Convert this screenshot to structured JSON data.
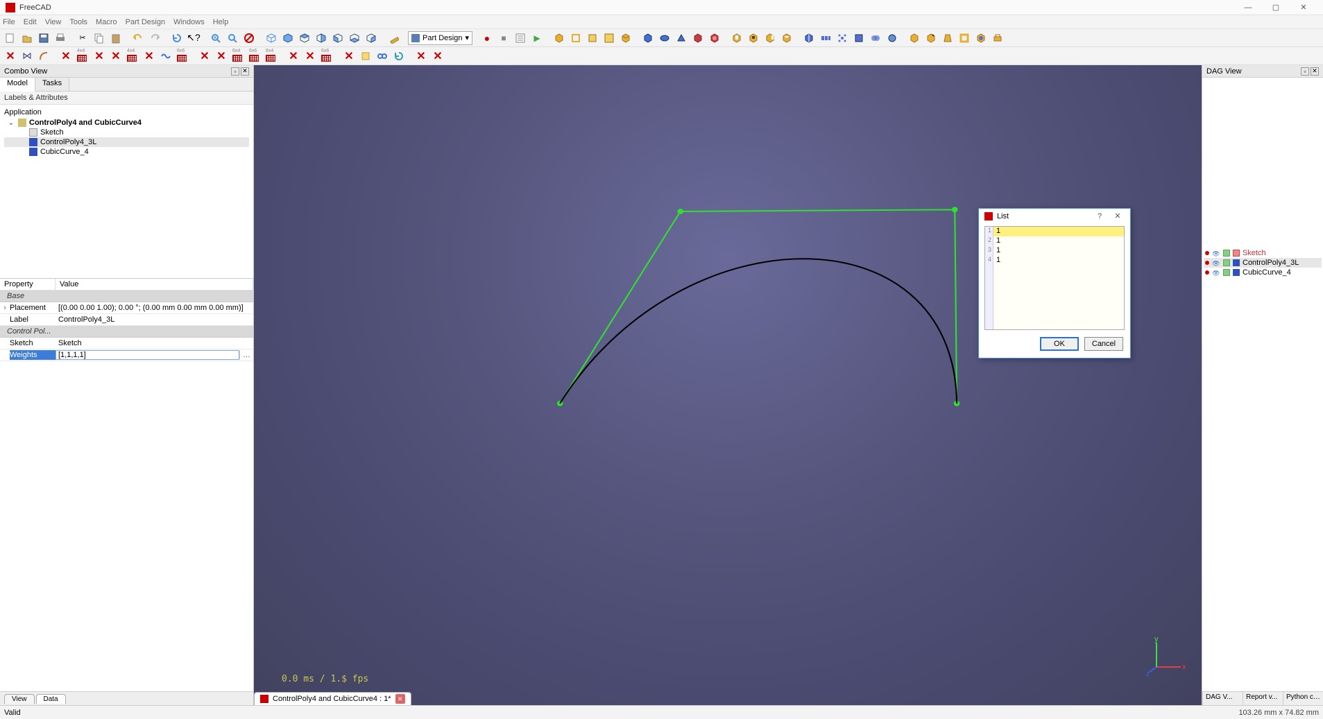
{
  "app": {
    "title": "FreeCAD"
  },
  "winbuttons": {
    "min": "—",
    "max": "▢",
    "close": "✕"
  },
  "menu": [
    "File",
    "Edit",
    "View",
    "Tools",
    "Macro",
    "Part Design",
    "Windows",
    "Help"
  ],
  "workbench": {
    "label": "Part Design"
  },
  "combo_view": {
    "title": "Combo View",
    "tabs": {
      "model": "Model",
      "tasks": "Tasks"
    },
    "labels_header": "Labels & Attributes",
    "app_label": "Application",
    "doc_label": "ControlPoly4 and CubicCurve4",
    "items": [
      {
        "name": "Sketch",
        "icon": "sketch"
      },
      {
        "name": "ControlPoly4_3L",
        "icon": "blue",
        "selected": true
      },
      {
        "name": "CubicCurve_4",
        "icon": "blue"
      }
    ]
  },
  "properties": {
    "headers": {
      "prop": "Property",
      "value": "Value"
    },
    "groups": [
      {
        "name": "Base",
        "rows": [
          {
            "k": "Placement",
            "v": "[(0.00 0.00 1.00); 0.00 °; (0.00 mm  0.00 mm  0.00 mm)]",
            "expandable": true
          },
          {
            "k": "Label",
            "v": "ControlPoly4_3L"
          }
        ]
      },
      {
        "name": "Control Pol...",
        "rows": [
          {
            "k": "Sketch",
            "v": "Sketch"
          },
          {
            "k": "Weights",
            "v": "[1,1,1,1]",
            "selected": true,
            "editbtn": true
          }
        ]
      }
    ],
    "bottom_tabs": {
      "view": "View",
      "data": "Data"
    }
  },
  "viewport": {
    "fps": "0.0 ms / 1.$ fps",
    "doc_tab": "ControlPoly4 and CubicCurve4 : 1*",
    "axes": {
      "x": "x",
      "y": "y",
      "z": "z"
    }
  },
  "dag_view": {
    "title": "DAG View",
    "items": [
      {
        "name": "Sketch",
        "kind": "sketch"
      },
      {
        "name": "ControlPoly4_3L",
        "kind": "blue",
        "selected": true
      },
      {
        "name": "CubicCurve_4",
        "kind": "blue"
      }
    ],
    "bottom": [
      "DAG V...",
      "Report v...",
      "Python con..."
    ]
  },
  "dialog": {
    "title": "List",
    "help": "?",
    "close": "✕",
    "rows": [
      "1",
      "1",
      "1",
      "1"
    ],
    "line_nums": [
      "1",
      "2",
      "3",
      "4"
    ],
    "ok": "OK",
    "cancel": "Cancel"
  },
  "status": {
    "left": "Valid",
    "right": "103.26 mm x 74.82 mm"
  },
  "toolbar2_grids": [
    "4x4",
    "4x4",
    "6x6",
    "6x4",
    "6x6",
    "6x4"
  ]
}
